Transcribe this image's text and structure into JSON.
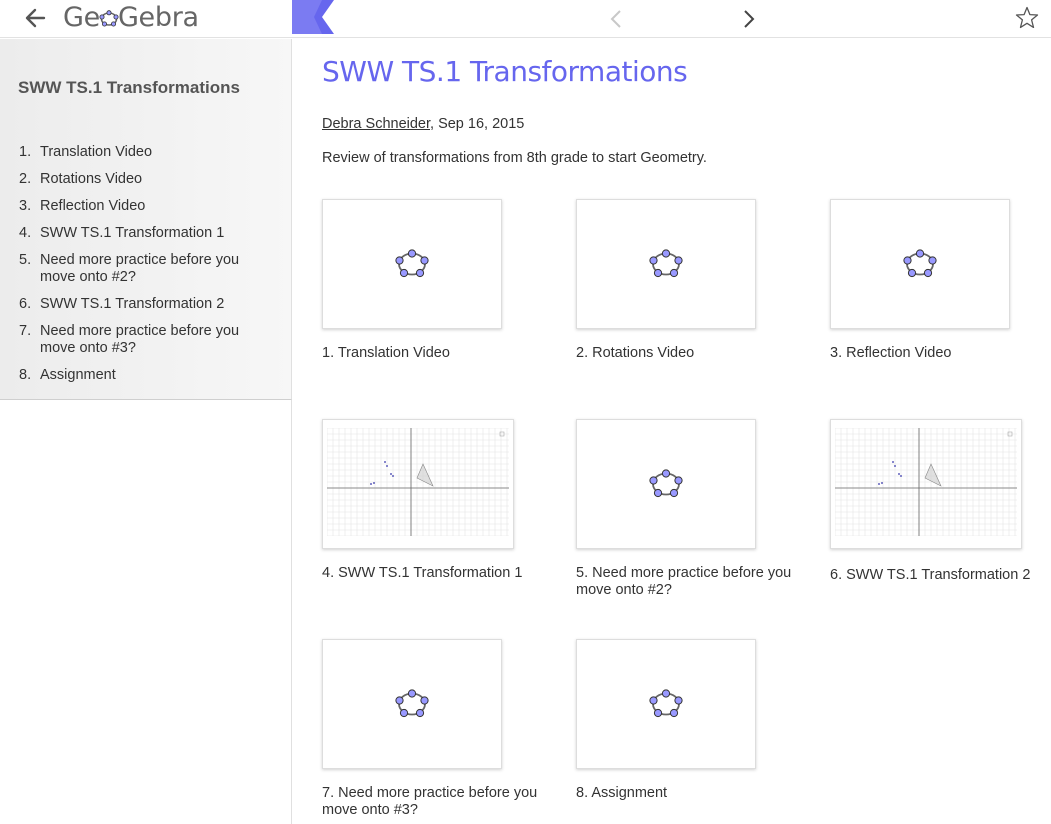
{
  "header": {
    "logo_text_left": "Ge",
    "logo_text_right": "Gebra",
    "accent_color": "#6666ee"
  },
  "sidebar": {
    "title": "SWW TS.1 Transformations",
    "items": [
      {
        "num": "1.",
        "label": "Translation Video"
      },
      {
        "num": "2.",
        "label": "Rotations Video"
      },
      {
        "num": "3.",
        "label": "Reflection Video"
      },
      {
        "num": "4.",
        "label": "SWW TS.1 Transformation 1"
      },
      {
        "num": "5.",
        "label": "Need more practice before you move onto #2?"
      },
      {
        "num": "6.",
        "label": "SWW TS.1 Transformation 2"
      },
      {
        "num": "7.",
        "label": "Need more practice before you move onto #3?"
      },
      {
        "num": "8.",
        "label": "Assignment"
      }
    ]
  },
  "main": {
    "title": "SWW TS.1 Transformations",
    "author": "Debra Schneider",
    "date": ", Sep 16, 2015",
    "description": "Review of transformations from 8th grade to start Geometry.",
    "cards": [
      {
        "label": "1. Translation Video",
        "thumb": "geogebra-logo-icon"
      },
      {
        "label": "2. Rotations Video",
        "thumb": "geogebra-logo-icon"
      },
      {
        "label": "3. Reflection Video",
        "thumb": "geogebra-logo-icon"
      },
      {
        "label": "4. SWW TS.1 Transformation 1",
        "thumb": "graph-grid"
      },
      {
        "label": "5. Need more practice before you move onto #2?",
        "thumb": "geogebra-logo-icon"
      },
      {
        "label": "6. SWW TS.1 Transformation 2",
        "thumb": "graph-grid"
      },
      {
        "label": "7. Need more practice before you move onto #3?",
        "thumb": "geogebra-logo-icon"
      },
      {
        "label": "8. Assignment",
        "thumb": "geogebra-logo-icon"
      }
    ]
  }
}
